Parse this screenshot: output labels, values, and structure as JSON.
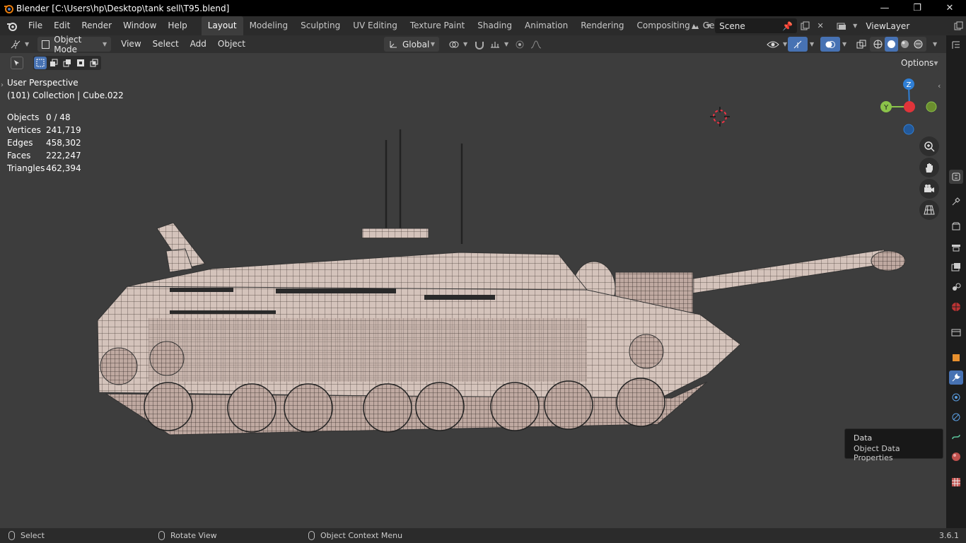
{
  "window": {
    "title": "Blender [C:\\Users\\hp\\Desktop\\tank sell\\T95.blend]",
    "minimize": "—",
    "maximize": "❐",
    "close": "✕"
  },
  "menu": [
    "File",
    "Edit",
    "Render",
    "Window",
    "Help"
  ],
  "workspaces": [
    "Layout",
    "Modeling",
    "Sculpting",
    "UV Editing",
    "Texture Paint",
    "Shading",
    "Animation",
    "Rendering",
    "Compositing",
    "Geometry Noc"
  ],
  "active_workspace": "Layout",
  "scene": {
    "name": "Scene"
  },
  "view_layer": {
    "name": "ViewLayer"
  },
  "viewport_header": {
    "mode": "Object Mode",
    "menus": [
      "View",
      "Select",
      "Add",
      "Object"
    ],
    "orientation": "Global",
    "options": "Options"
  },
  "viewport": {
    "perspective": "User Perspective",
    "collection": "(101) Collection | Cube.022",
    "stats": [
      {
        "label": "Objects",
        "value": "0 / 48"
      },
      {
        "label": "Vertices",
        "value": "241,719"
      },
      {
        "label": "Edges",
        "value": "458,302"
      },
      {
        "label": "Faces",
        "value": "222,247"
      },
      {
        "label": "Triangles",
        "value": "462,394"
      }
    ],
    "gizmo": {
      "z": "Z",
      "y": "Y"
    }
  },
  "tooltip": {
    "title": "Data",
    "description": "Object Data Properties"
  },
  "statusbar": {
    "select": "Select",
    "rotate": "Rotate View",
    "context": "Object Context Menu",
    "version": "3.6.1"
  },
  "colors": {
    "accent": "#4772b3",
    "axis_x": "#e0343a",
    "axis_y": "#8bc34a",
    "axis_z": "#2f7fd6"
  }
}
